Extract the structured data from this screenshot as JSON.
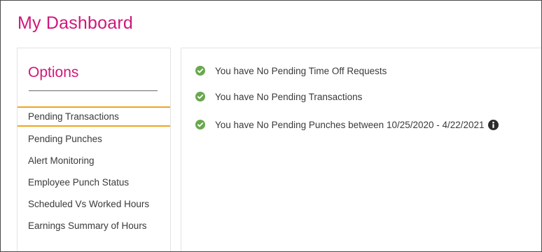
{
  "header": {
    "title": "My Dashboard"
  },
  "options": {
    "title": "Options",
    "items": [
      {
        "label": "Pending Transactions",
        "active": true
      },
      {
        "label": "Pending Punches",
        "active": false
      },
      {
        "label": "Alert Monitoring",
        "active": false
      },
      {
        "label": "Employee Punch Status",
        "active": false
      },
      {
        "label": "Scheduled Vs Worked Hours",
        "active": false
      },
      {
        "label": "Earnings Summary of Hours",
        "active": false
      }
    ]
  },
  "main": {
    "statuses": [
      {
        "text": "You have No Pending Time Off Requests",
        "icon": "check-circle-icon"
      },
      {
        "text": "You have No Pending Transactions",
        "icon": "check-circle-icon"
      },
      {
        "text": "You have No Pending Punches between 10/25/2020 - 4/22/2021",
        "icon": "check-circle-icon",
        "info_icon": "info-circle-icon"
      }
    ]
  },
  "colors": {
    "brand_pink": "#d0177a",
    "active_underline": "#f0a420",
    "success_green": "#6aa84f",
    "text": "#3a3a3a"
  }
}
